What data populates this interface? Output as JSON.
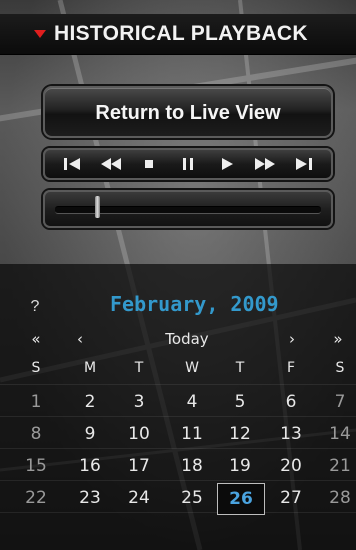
{
  "header": {
    "title": "HISTORICAL PLAYBACK",
    "collapse_icon": "triangle-down-icon",
    "accent_color": "#e01e1e"
  },
  "live_button": {
    "label": "Return to Live View"
  },
  "transport": {
    "buttons": [
      {
        "name": "skip-to-start-icon"
      },
      {
        "name": "rewind-icon"
      },
      {
        "name": "stop-icon"
      },
      {
        "name": "pause-icon"
      },
      {
        "name": "play-icon"
      },
      {
        "name": "fast-forward-icon"
      },
      {
        "name": "skip-to-end-icon"
      }
    ]
  },
  "playback_slider": {
    "position": 0.15
  },
  "calendar": {
    "help": "?",
    "month_label": "February, 2009",
    "month_color": "#3399cc",
    "nav": {
      "prev_year": "«",
      "prev_month": "‹",
      "today": "Today",
      "next_month": "›",
      "next_year": "»"
    },
    "weekdays": [
      "S",
      "M",
      "T",
      "W",
      "T",
      "F",
      "S"
    ],
    "weeks": [
      [
        "1",
        "2",
        "3",
        "4",
        "5",
        "6",
        "7"
      ],
      [
        "8",
        "9",
        "10",
        "11",
        "12",
        "13",
        "14"
      ],
      [
        "15",
        "16",
        "17",
        "18",
        "19",
        "20",
        "21"
      ],
      [
        "22",
        "23",
        "24",
        "25",
        "26",
        "27",
        "28"
      ]
    ],
    "selected_day": "26"
  }
}
